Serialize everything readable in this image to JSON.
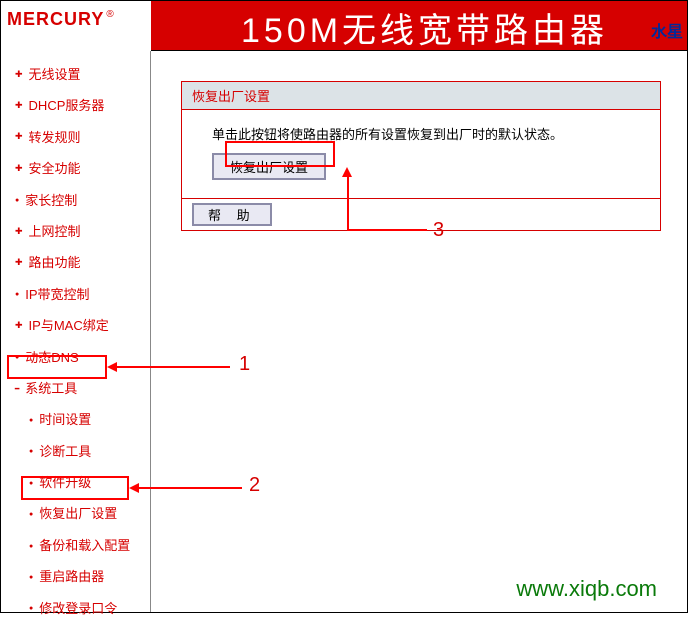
{
  "header": {
    "logo": "MERCURY",
    "title": "150M无线宽带路由器",
    "subtitle": "水星"
  },
  "sidebar": {
    "items": [
      {
        "label": "无线设置",
        "type": "plus"
      },
      {
        "label": "DHCP服务器",
        "type": "plus"
      },
      {
        "label": "转发规则",
        "type": "plus"
      },
      {
        "label": "安全功能",
        "type": "plus"
      },
      {
        "label": "家长控制",
        "type": "dot"
      },
      {
        "label": "上网控制",
        "type": "plus"
      },
      {
        "label": "路由功能",
        "type": "plus"
      },
      {
        "label": "IP带宽控制",
        "type": "dot"
      },
      {
        "label": "IP与MAC绑定",
        "type": "plus"
      },
      {
        "label": "动态DNS",
        "type": "dot"
      },
      {
        "label": "系统工具",
        "type": "minus"
      }
    ],
    "subitems": [
      {
        "label": "时间设置"
      },
      {
        "label": "诊断工具"
      },
      {
        "label": "软件升级"
      },
      {
        "label": "恢复出厂设置"
      },
      {
        "label": "备份和载入配置"
      },
      {
        "label": "重启路由器"
      },
      {
        "label": "修改登录口令"
      }
    ]
  },
  "panel": {
    "title": "恢复出厂设置",
    "desc": "单击此按钮将使路由器的所有设置恢复到出厂时的默认状态。",
    "reset_btn": "恢复出厂设置",
    "help_btn": "帮 助"
  },
  "annotations": {
    "label1": "1",
    "label2": "2",
    "label3": "3"
  },
  "watermark": "www.xiqb.com"
}
